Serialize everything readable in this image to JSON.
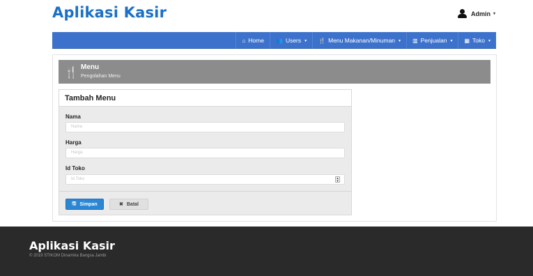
{
  "app": {
    "brand": "Aplikasi Kasir"
  },
  "user": {
    "name": "Admin",
    "icon": "user-icon",
    "caret": "▾"
  },
  "navbar": {
    "items": [
      {
        "icon": "home-icon",
        "glyph": "⌂",
        "label": "Home",
        "dropdown": ""
      },
      {
        "icon": "users-icon",
        "glyph": "👥",
        "label": "Users",
        "dropdown": "▾"
      },
      {
        "icon": "cutlery-icon",
        "glyph": "🍴",
        "label": "Menu Makanan/Minuman",
        "dropdown": "▾"
      },
      {
        "icon": "bar-chart-icon",
        "glyph": "▥",
        "label": "Penjualan",
        "dropdown": "▾"
      },
      {
        "icon": "table-icon",
        "glyph": "▦",
        "label": "Toko",
        "dropdown": "▾"
      }
    ]
  },
  "page_header": {
    "icon": "cutlery-icon",
    "glyph": "🍴",
    "title": "Menu",
    "subtitle": "Pengolahan Menu"
  },
  "form": {
    "title": "Tambah Menu",
    "fields": [
      {
        "label": "Nama",
        "placeholder": "Nama",
        "value": ""
      },
      {
        "label": "Harga",
        "placeholder": "Harga",
        "value": ""
      },
      {
        "label": "Id Toko",
        "placeholder": "Id Toko",
        "value": ""
      }
    ],
    "save_label": "Simpan",
    "save_icon": "save-icon",
    "save_glyph": "🖫",
    "cancel_label": "Batal",
    "cancel_icon": "close-icon",
    "cancel_glyph": "✖"
  },
  "footer": {
    "brand": "Aplikasi Kasir",
    "copyright": "© 2019 STIKOM Dinamika Bangsa Jambi"
  },
  "colors": {
    "brand": "#1b70c6",
    "navbar": "#3d72cc",
    "header": "#8c8c8c",
    "save": "#2b87d4",
    "footer": "#2a2a2a"
  }
}
